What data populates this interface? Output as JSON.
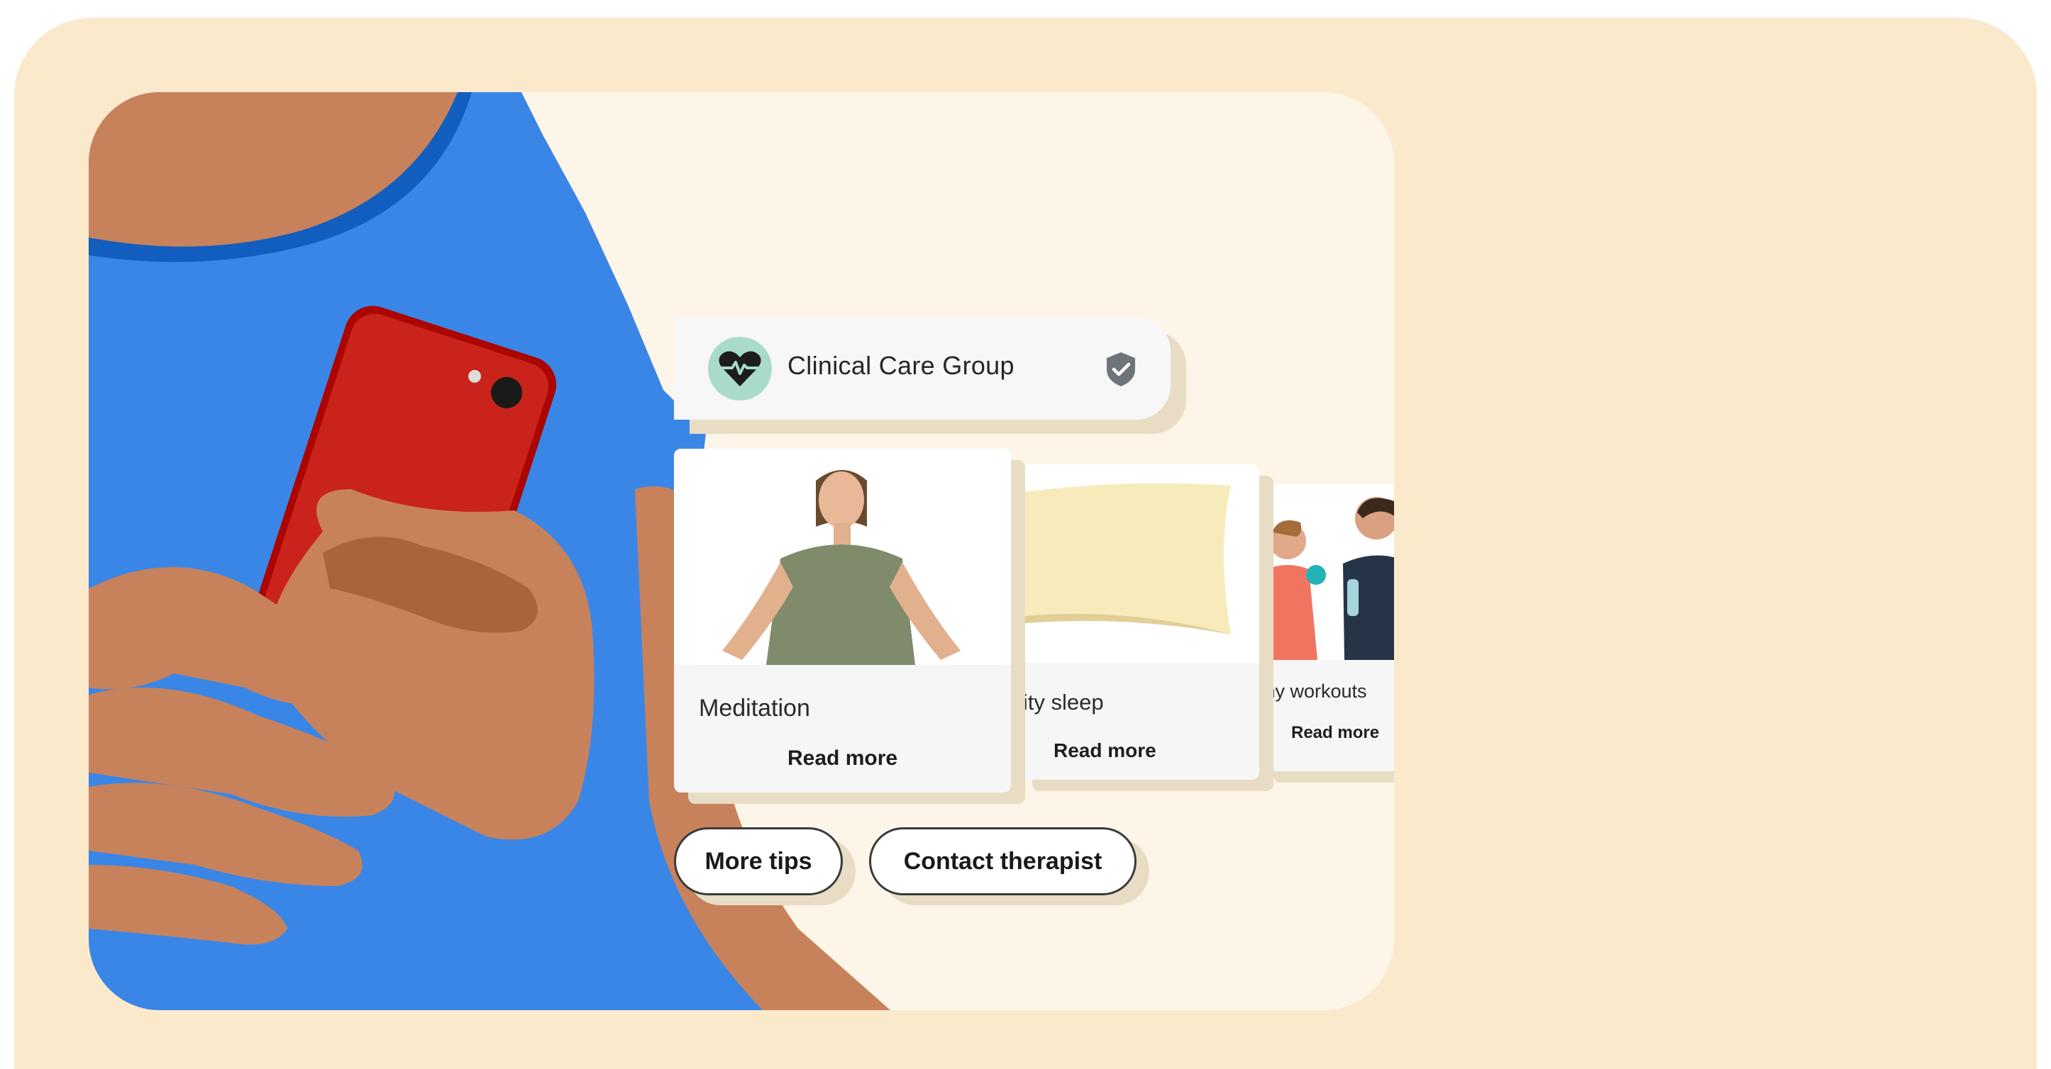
{
  "colors": {
    "outer_background": "#fbe9cc",
    "panel_background": "#fdf6e8",
    "shirt": "#3a86e6",
    "skin": "#c7825c",
    "phone": "#c9231b",
    "logo_circle": "#a9dcc8",
    "verified_badge": "#6e7478"
  },
  "business": {
    "name": "Clinical Care Group",
    "logo_icon": "heart-pulse-icon",
    "verified_icon": "verified-shield-icon"
  },
  "cards": [
    {
      "title": "Meditation",
      "link": "Read more",
      "image": "meditating-woman"
    },
    {
      "title": "lity sleep",
      "link": "Read more",
      "image": "pillow"
    },
    {
      "title": "thy workouts",
      "link": "Read more",
      "image": "workout-couple"
    }
  ],
  "chips": [
    {
      "label": "More tips"
    },
    {
      "label": "Contact therapist"
    }
  ]
}
